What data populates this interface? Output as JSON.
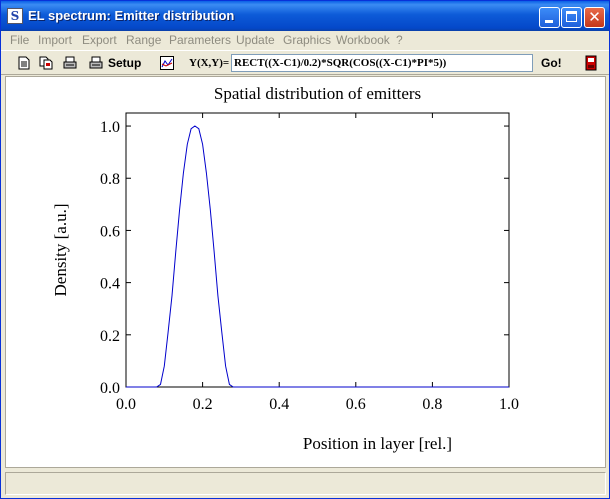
{
  "window": {
    "title": "EL spectrum: Emitter distribution",
    "app_icon": "S"
  },
  "menu": {
    "items": [
      "File",
      "Import",
      "Export",
      "Range",
      "Parameters",
      "Update",
      "Graphics",
      "Workbook",
      "?"
    ]
  },
  "toolbar": {
    "icons": [
      "new-document-icon",
      "copy-document-icon",
      "print-icon",
      "print-setup-icon",
      "graph-settings-icon",
      "exit-icon"
    ],
    "setup_label": "Setup",
    "formula_label": "Y(X,Y)=",
    "formula_value": "RECT((X-C1)/0.2)*SQR(COS((X-C1)*PI*5))",
    "go_label": "Go!"
  },
  "status": {
    "text": ""
  },
  "chart_data": {
    "type": "line",
    "title": "Spatial distribution of emitters",
    "xlabel": "Position in layer [rel.]",
    "ylabel": "Density [a.u.]",
    "xlim": [
      0,
      1
    ],
    "ylim": [
      0,
      1.05
    ],
    "x_ticks": [
      "0.0",
      "0.2",
      "0.4",
      "0.6",
      "0.8",
      "1.0"
    ],
    "y_ticks": [
      "0.0",
      "0.2",
      "0.4",
      "0.6",
      "0.8",
      "1.0"
    ],
    "grid": false,
    "line_color": "#0000CC",
    "series": [
      {
        "x": [
          0.0,
          0.08,
          0.09,
          0.1,
          0.11,
          0.12,
          0.13,
          0.14,
          0.15,
          0.16,
          0.17,
          0.18,
          0.19,
          0.2,
          0.21,
          0.22,
          0.23,
          0.24,
          0.25,
          0.26,
          0.27,
          0.28,
          0.29,
          1.0
        ],
        "y": [
          0.0,
          0.0,
          0.01,
          0.08,
          0.21,
          0.35,
          0.52,
          0.68,
          0.82,
          0.93,
          0.99,
          1.0,
          0.99,
          0.93,
          0.82,
          0.68,
          0.52,
          0.35,
          0.21,
          0.08,
          0.01,
          0.0,
          0.0,
          0.0
        ]
      }
    ]
  }
}
